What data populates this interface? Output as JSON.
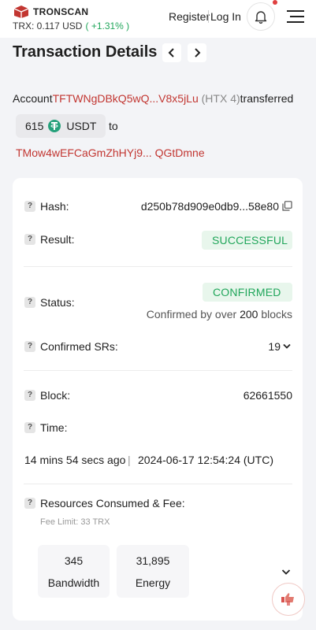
{
  "header": {
    "brand": "TRONSCAN",
    "price_label": "TRX: 0.117 USD",
    "price_change": "( +1.31% )",
    "register": "Register",
    "login": "Log In"
  },
  "page": {
    "title": "Transaction Details"
  },
  "summary": {
    "account_word": "Account",
    "from_address": "TFTWNgDBkQ5wQ...V8x5jLu",
    "from_tag": "(HTX 4)",
    "transferred_word": "transferred",
    "amount": "615",
    "token": "USDT",
    "to_word": "to",
    "to_address": "TMow4wEFCaGmZhHYj9... QGtDmne"
  },
  "details": {
    "hash_label": "Hash:",
    "hash_value": "d250b78d909e0db9...58e80",
    "result_label": "Result:",
    "result_value": "SUCCESSFUL",
    "status_label": "Status:",
    "status_value": "CONFIRMED",
    "confirmed_by_prefix": "Confirmed by over",
    "confirmed_blocks": "200",
    "confirmed_by_suffix": "blocks",
    "srs_label": "Confirmed SRs:",
    "srs_value": "19",
    "block_label": "Block:",
    "block_value": "62661550",
    "time_label": "Time:",
    "time_ago": "14 mins 54 secs ago",
    "time_sep": "|",
    "time_value": "2024-06-17 12:54:24 (UTC)",
    "resources_label": "Resources Consumed & Fee:",
    "fee_limit": "Fee Limit: 33 TRX",
    "bandwidth_value": "345",
    "bandwidth_label": "Bandwidth",
    "energy_value": "31,895",
    "energy_label": "Energy"
  },
  "colors": {
    "accent_red": "#c23631",
    "success_green": "#21a65b",
    "success_bg": "#e8f6ec"
  },
  "icons": [
    "tronscan-logo-icon",
    "bell-icon",
    "menu-icon",
    "chevron-left-icon",
    "chevron-right-icon",
    "usdt-token-icon",
    "copy-icon",
    "help-icon",
    "chevron-down-icon",
    "thumbs-feedback-icon"
  ]
}
